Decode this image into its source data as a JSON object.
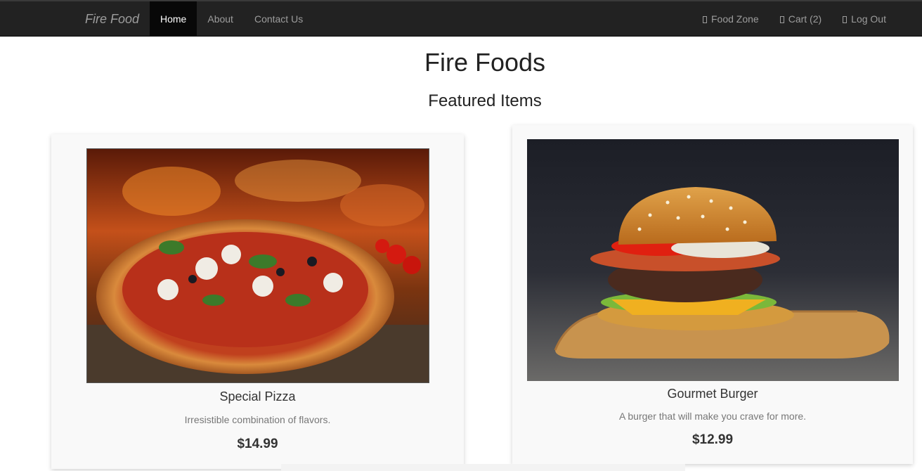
{
  "navbar": {
    "brand": "Fire Food",
    "left_items": [
      "Home",
      "About",
      "Contact Us"
    ],
    "active_item": "Home",
    "right_items": [
      {
        "label": "Food Zone",
        "icon": "food-icon"
      },
      {
        "label": "Cart (2)",
        "icon": "cart-icon"
      },
      {
        "label": "Log Out",
        "icon": "logout-icon"
      }
    ]
  },
  "main": {
    "title": "Fire Foods",
    "section_title": "Featured Items",
    "items": [
      {
        "name": "Special Pizza",
        "description": "Irresistible combination of flavors.",
        "price": "$14.99"
      },
      {
        "name": "Gourmet Burger",
        "description": "A burger that will make you crave for more.",
        "price": "$12.99"
      }
    ]
  },
  "colors": {
    "navbar_bg": "#222222",
    "active_bg": "#080808",
    "card_bg": "#f9f9f9"
  }
}
